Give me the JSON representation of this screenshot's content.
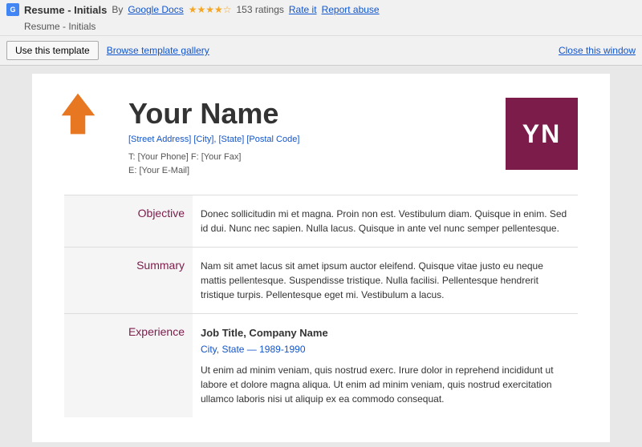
{
  "topbar": {
    "icon_label": "G",
    "title": "Resume - Initials",
    "by_text": "By",
    "author": "Google Docs",
    "stars": "★★★★☆",
    "ratings_count": "153 ratings",
    "rate_label": "Rate it",
    "abuse_label": "Report abuse",
    "subtitle": "Resume - Initials"
  },
  "actionbar": {
    "use_template_label": "Use this template",
    "browse_label": "Browse template gallery",
    "close_label": "Close this window"
  },
  "document": {
    "name": "Your Name",
    "address": "[Street Address] [City], [State] [Postal Code]",
    "phone_line": "T: [Your Phone]  F: [Your Fax]",
    "email_line": "E: [Your E-Mail]",
    "initials": "YN",
    "sections": [
      {
        "label": "Objective",
        "content": "Donec sollicitudin mi et magna. Proin non est. Vestibulum diam. Quisque in enim. Sed id dui. Nunc nec sapien. Nulla lacus. Quisque in ante vel nunc semper pellentesque."
      },
      {
        "label": "Summary",
        "content": "Nam sit amet lacus sit amet ipsum auctor eleifend. Quisque vitae justo eu neque mattis pellentesque. Suspendisse tristique. Nulla facilisi. Pellentesque hendrerit tristique turpis. Pellentesque eget mi. Vestibulum a lacus."
      },
      {
        "label": "Experience",
        "job_title": "Job Title, Company Name",
        "job_location": "City, State — 1989-1990",
        "job_desc": "Ut enim ad minim veniam, quis nostrud exerc. Irure dolor in reprehend incididunt ut labore et dolore magna aliqua. Ut enim ad minim veniam, quis nostrud exercitation ullamco laboris nisi ut aliquip ex ea commodo consequat."
      }
    ]
  }
}
